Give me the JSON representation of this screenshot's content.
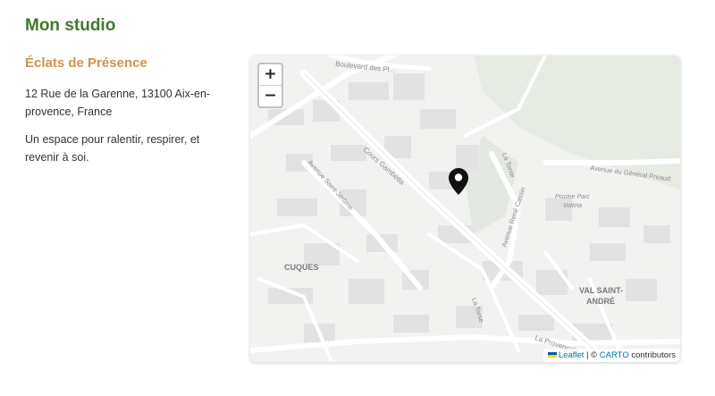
{
  "page": {
    "title": "Mon studio"
  },
  "studio": {
    "name": "Éclats de Présence",
    "address": "12 Rue de la Garenne, 13100 Aix-en-provence, France",
    "tagline": "Un espace pour ralentir, respirer, et revenir à soi."
  },
  "map": {
    "zoom_in": "+",
    "zoom_out": "−",
    "marker_icon": "map-pin-icon",
    "labels": {
      "boulevard": "Boulevard des Pl...",
      "cours_gambetta": "Cours Gambetta",
      "avenue_saint_jerome": "Avenue Saint-Jérôme",
      "la_torse": "La Torse",
      "avenue_rene_cassin": "Avenue René Cassin",
      "avenue_general": "Avenue du Général Preaud",
      "piscine": "Piscine Parc",
      "piscine2": "Voltina",
      "cuques": "CUQUES",
      "val_saint": "VAL SAINT-",
      "andre": "ANDRÉ",
      "la_provencale": "La Provençale",
      "la_torse2": "La Torse"
    },
    "attribution": {
      "leaflet": "Leaflet",
      "separator": " | © ",
      "carto": "CARTO",
      "contributors": " contributors"
    }
  },
  "colors": {
    "title_green": "#3d7a2c",
    "name_orange": "#d4924a",
    "link_blue": "#0078a8"
  }
}
